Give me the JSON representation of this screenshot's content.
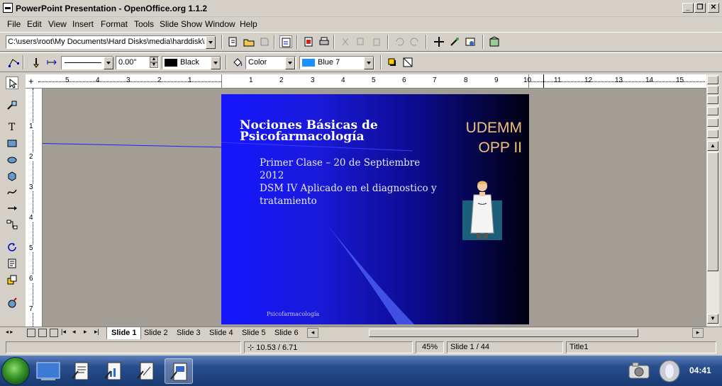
{
  "window": {
    "title": "PowerPoint Presentation - OpenOffice.org 1.1.2"
  },
  "menu": [
    "File",
    "Edit",
    "View",
    "Insert",
    "Format",
    "Tools",
    "Slide Show",
    "Window",
    "Help"
  ],
  "toolbar": {
    "url": "C:\\users\\root\\My Documents\\Hard Disks\\media\\harddisk\\D",
    "line_width": "0.00\"",
    "line_color": "Black",
    "area_style": "Color",
    "area_color": "Blue 7"
  },
  "ruler": {
    "horizontal": [
      "5",
      "4",
      "3",
      "2",
      "1",
      "1",
      "2",
      "3",
      "4",
      "5",
      "6",
      "7",
      "8",
      "9",
      "10",
      "11",
      "12",
      "13",
      "14",
      "15"
    ],
    "vertical": [
      "1",
      "2",
      "3",
      "4",
      "5",
      "6",
      "7"
    ]
  },
  "slide": {
    "title": "Nociones Básicas de Psicofarmacología",
    "org_line1": "UDEMM",
    "org_line2": "OPP II",
    "bullet1": "Primer Clase – 20 de Septiembre 2012",
    "bullet2": "DSM IV Aplicado en el diagnostico y tratamiento",
    "footer": "Psicofarmacología"
  },
  "tabs": [
    "Slide 1",
    "Slide 2",
    "Slide 3",
    "Slide 4",
    "Slide 5",
    "Slide 6"
  ],
  "status": {
    "position": "10.53 / 6.71",
    "zoom": "45%",
    "page": "Slide 1 / 44",
    "layout": "Title1"
  },
  "taskbar": {
    "clock": "04:41"
  },
  "colors": {
    "line_swatch": "#000000",
    "area_swatch": "#1e90ff",
    "slide_title": "#ffffff",
    "slide_org": "#f2c07a"
  }
}
